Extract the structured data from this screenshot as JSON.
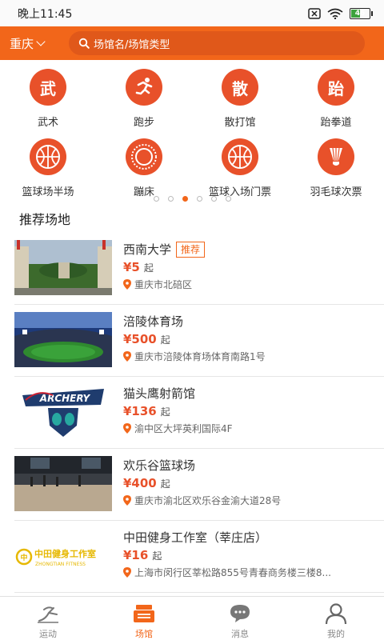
{
  "status_bar": {
    "time": "晚上11:45",
    "battery": "46"
  },
  "header": {
    "city": "重庆",
    "search_placeholder": "场馆名/场馆类型"
  },
  "categories": [
    {
      "label": "武术",
      "glyph": "武",
      "icon": "wushu-icon"
    },
    {
      "label": "跑步",
      "glyph": "",
      "icon": "running-icon"
    },
    {
      "label": "散打馆",
      "glyph": "散",
      "icon": "sanda-icon"
    },
    {
      "label": "跆拳道",
      "glyph": "跆",
      "icon": "taekwondo-icon"
    },
    {
      "label": "篮球场半场",
      "glyph": "",
      "icon": "basketball-icon"
    },
    {
      "label": "蹦床",
      "glyph": "",
      "icon": "trampoline-icon"
    },
    {
      "label": "篮球入场门票",
      "glyph": "",
      "icon": "basketball-ticket-icon"
    },
    {
      "label": "羽毛球次票",
      "glyph": "",
      "icon": "badminton-icon"
    }
  ],
  "pager": {
    "count": 6,
    "active": 2
  },
  "section": {
    "title": "推荐场地"
  },
  "venues": [
    {
      "name": "西南大学",
      "badge": "推荐",
      "price": "¥5",
      "unit": "起",
      "address": "重庆市北碚区"
    },
    {
      "name": "涪陵体育场",
      "badge": "",
      "price": "¥500",
      "unit": "起",
      "address": "重庆市涪陵体育场体育南路1号"
    },
    {
      "name": "猫头鹰射箭馆",
      "badge": "",
      "price": "¥136",
      "unit": "起",
      "address": "渝中区大坪英利国际4F"
    },
    {
      "name": "欢乐谷篮球场",
      "badge": "",
      "price": "¥400",
      "unit": "起",
      "address": "重庆市渝北区欢乐谷金渝大道28号"
    },
    {
      "name": "中田健身工作室（莘庄店）",
      "badge": "",
      "price": "¥16",
      "unit": "起",
      "address": "上海市闵行区莘松路855号青春商务楼三楼8..."
    }
  ],
  "logo_text": {
    "archery": "ARCHERY",
    "zhongtian_cn": "中田健身工作室",
    "zhongtian_en": "ZHONGTIAN FITNESS"
  },
  "tabs": [
    {
      "label": "运动",
      "icon": "sport-icon",
      "active": false
    },
    {
      "label": "场馆",
      "icon": "venue-icon",
      "active": true
    },
    {
      "label": "消息",
      "icon": "message-icon",
      "active": false
    },
    {
      "label": "我的",
      "icon": "profile-icon",
      "active": false
    }
  ],
  "colors": {
    "accent": "#f2661a",
    "category": "#e8512a",
    "price": "#e8512a",
    "inactive_tab": "#888888"
  }
}
